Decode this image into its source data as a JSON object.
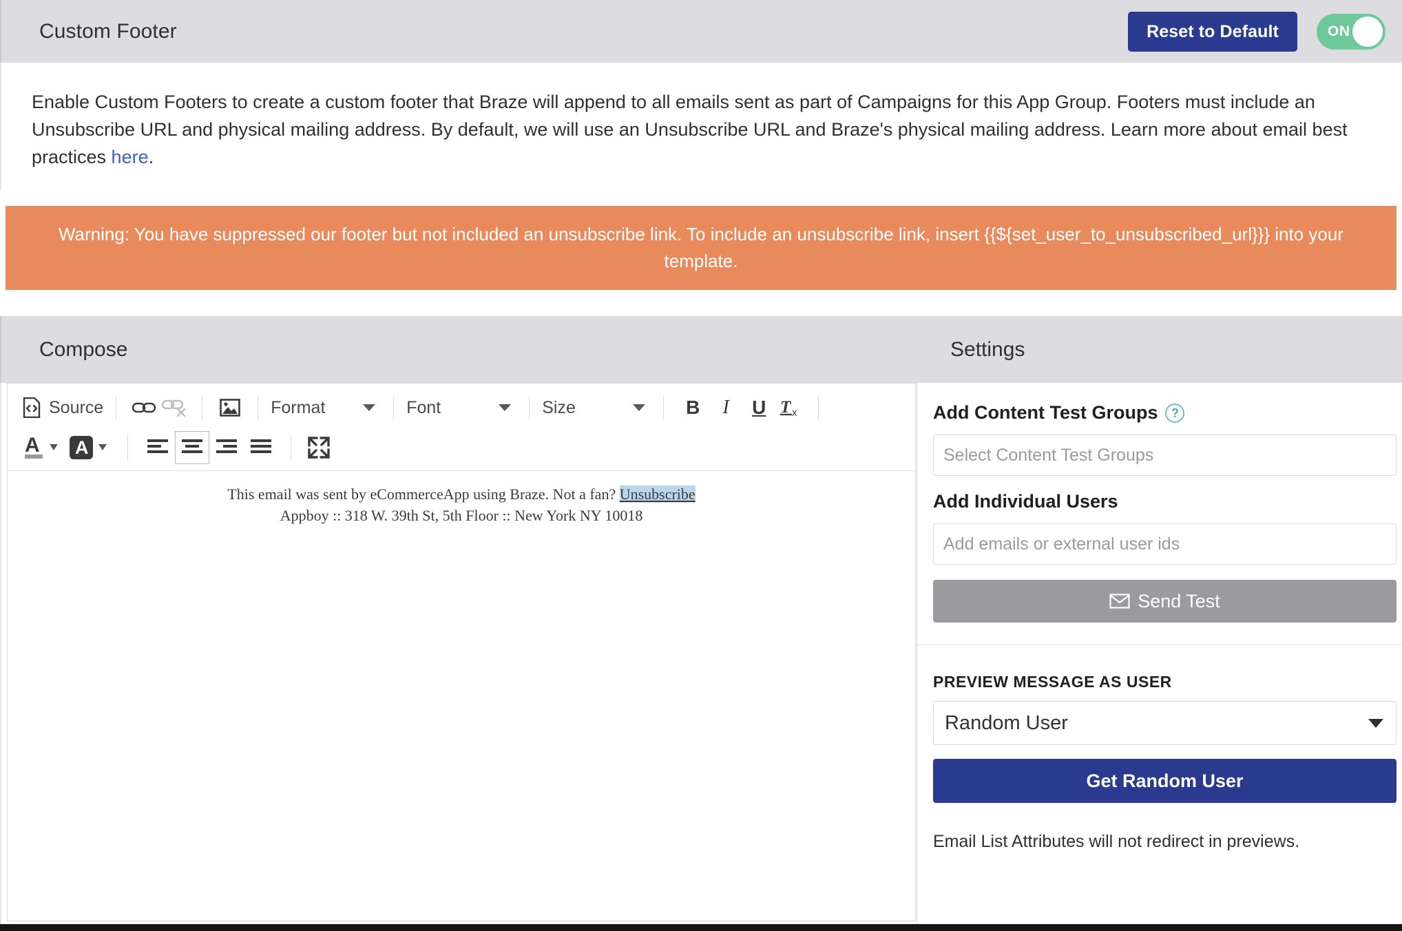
{
  "header": {
    "title": "Custom Footer",
    "reset_button": "Reset to Default",
    "toggle_state": "ON"
  },
  "description": {
    "text_before_link": "Enable Custom Footers to create a custom footer that Braze will append to all emails sent as part of Campaigns for this App Group. Footers must include an Unsubscribe URL and physical mailing address. By default, we will use an Unsubscribe URL and Braze's physical mailing address. Learn more about email best practices ",
    "link_text": "here",
    "text_after_link": "."
  },
  "warning": {
    "text": "Warning: You have suppressed our footer but not included an unsubscribe link. To include an unsubscribe link, insert {{${set_user_to_unsubscribed_url}}} into your template."
  },
  "sections": {
    "compose_title": "Compose",
    "settings_title": "Settings"
  },
  "toolbar": {
    "source_label": "Source",
    "format_label": "Format",
    "font_label": "Font",
    "size_label": "Size",
    "bold_label": "B",
    "italic_label": "I",
    "underline_label": "U",
    "remove_format_label": "Tx",
    "icons": {
      "source": "source-code-icon",
      "link": "link-icon",
      "unlink": "unlink-icon",
      "image": "image-icon",
      "text_color": "text-color-icon",
      "background_color": "background-color-icon",
      "align_left": "align-left-icon",
      "align_center": "align-center-icon",
      "align_right": "align-right-icon",
      "align_justify": "align-justify-icon",
      "maximize": "maximize-icon"
    },
    "active_alignment": "align-center"
  },
  "editor": {
    "line1_before_link": "This email was sent by eCommerceApp using Braze. Not a fan? ",
    "line1_link": "Unsubscribe",
    "line2": "Appboy :: 318 W. 39th St, 5th Floor :: New York NY 10018"
  },
  "settings": {
    "content_test_groups_label": "Add Content Test Groups",
    "content_test_groups_placeholder": "Select Content Test Groups",
    "content_test_groups_value": "",
    "individual_users_label": "Add Individual Users",
    "individual_users_placeholder": "Add emails or external user ids",
    "individual_users_value": "",
    "send_test_label": "Send Test",
    "send_test_icon": "envelope-icon",
    "preview_section_label": "PREVIEW MESSAGE AS USER",
    "preview_user_value": "Random User",
    "get_random_user_label": "Get Random User",
    "note": "Email List Attributes will not redirect in previews."
  },
  "colors": {
    "brand_blue": "#2a3b8f",
    "toggle_green": "#6dc99a",
    "warning_orange": "#e98a5c",
    "header_gray": "#dcdce1",
    "disabled_gray": "#9a9a9f",
    "link_blue": "#3a62c4",
    "help_teal": "#6fc0c4"
  }
}
